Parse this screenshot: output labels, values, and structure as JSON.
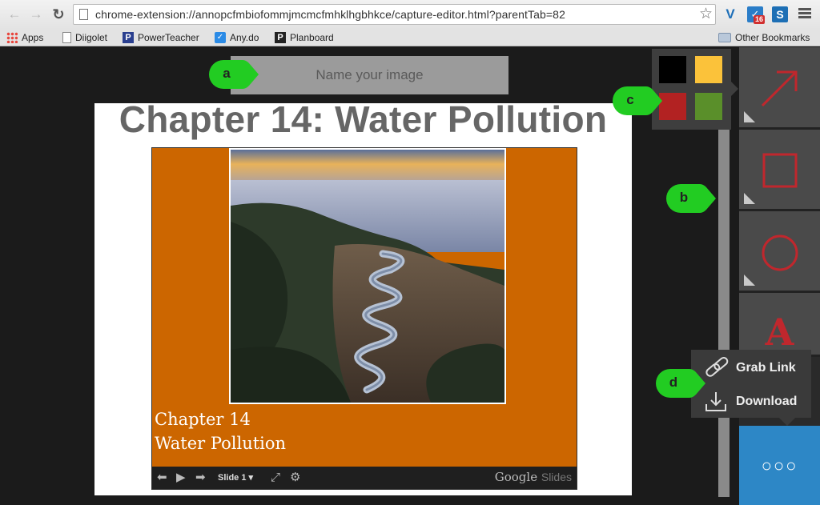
{
  "browser": {
    "url": "chrome-extension://annopcfmbiofommjmcmcfmhklhgbhkce/capture-editor.html?parentTab=82",
    "back_icon": "back-arrow-icon",
    "forward_icon": "forward-arrow-icon",
    "reload_icon": "reload-icon",
    "bookmark_star_icon": "star-icon",
    "extension_badge": "16",
    "bookmarks": [
      {
        "label": "Apps",
        "icon": "apps-icon"
      },
      {
        "label": "Diigolet",
        "icon": "document-icon"
      },
      {
        "label": "PowerTeacher",
        "icon": "powerteacher-icon"
      },
      {
        "label": "Any.do",
        "icon": "anydo-icon"
      },
      {
        "label": "Planboard",
        "icon": "planboard-icon"
      }
    ],
    "other_bookmarks": "Other Bookmarks"
  },
  "editor": {
    "name_placeholder": "Name your image",
    "slide": {
      "title": "Chapter 14: Water Pollution",
      "caption_line1": "Chapter 14",
      "caption_line2": "Water Pollution",
      "player": {
        "slide_label": "Slide 1",
        "logo_main": "Google",
        "logo_sub": "Slides"
      }
    }
  },
  "colors": {
    "palette": [
      "#000000",
      "#fbc23a",
      "#b22222",
      "#5a8f2a"
    ]
  },
  "tools": {
    "arrow_icon": "arrow-tool-icon",
    "rectangle_icon": "rectangle-tool-icon",
    "ellipse_icon": "ellipse-tool-icon",
    "text_label": "A",
    "more_label": "○○○",
    "accent": "#c0272d",
    "more_bg": "#2d87c6"
  },
  "share_menu": {
    "grab_link": "Grab Link",
    "download": "Download"
  },
  "callouts": {
    "a": "a",
    "b": "b",
    "c": "c",
    "d": "d",
    "color": "#22cc22"
  }
}
